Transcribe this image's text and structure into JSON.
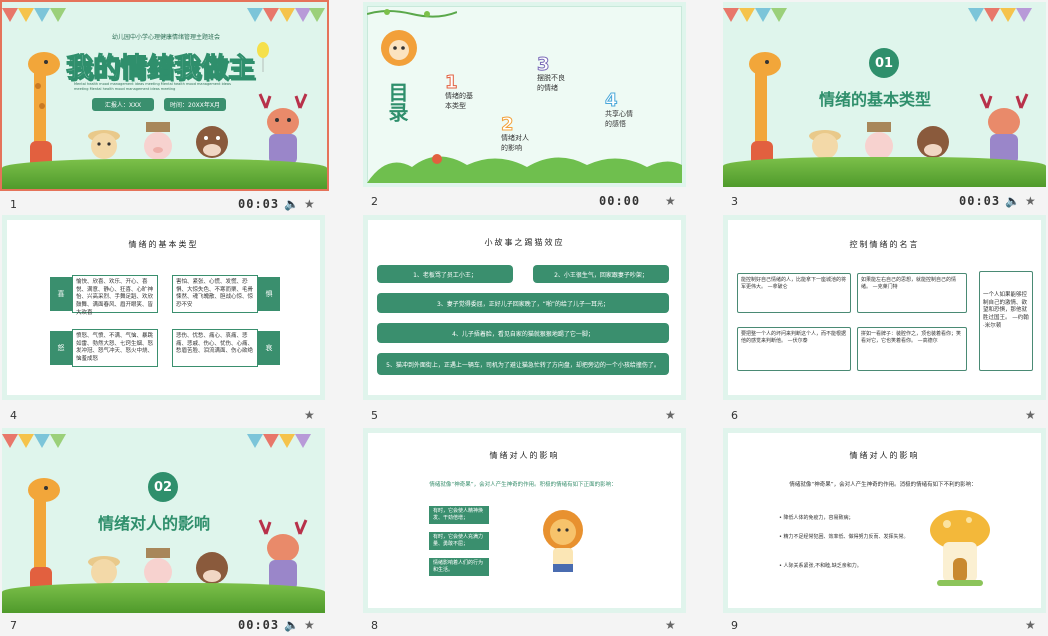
{
  "slides": [
    {
      "num": "1",
      "time": "00:03",
      "title": "我的情绪我做主",
      "subtitle": "幼儿园中小学心理健康情绪管理主题班会",
      "eng": "Mental health mood management ideas meeting Mental health mood management ideas meeting Mental health mood management ideas meeting",
      "reporter": "汇报人：XXX",
      "date": "时间：20XX年X月"
    },
    {
      "num": "2",
      "time": "00:00",
      "toc": "目录",
      "items": [
        {
          "n": "1",
          "text": "情绪的基本类型"
        },
        {
          "n": "2",
          "text": "情绪对人的影响"
        },
        {
          "n": "3",
          "text": "摆脱不良的情绪"
        },
        {
          "n": "4",
          "text": "共享心情的感悟"
        }
      ]
    },
    {
      "num": "3",
      "time": "00:03",
      "badge": "01",
      "title": "情绪的基本类型"
    },
    {
      "num": "4",
      "title": "情绪的基本类型",
      "left": [
        {
          "label": "喜",
          "text": "愉快、欣喜、欢乐、开心、喜悦、满意、静心、狂喜、心旷神怡、兴高采烈、手舞足蹈、欢欣鼓舞、满面春风、眉开眼笑、皆大欢喜"
        },
        {
          "label": "怒",
          "text": "愤怒、气愤、不满、气恼、暴跳如雷、勃然大怒、七窍生烟、怒发冲冠、怒气冲天、怒火中烧、恼羞成怒"
        }
      ],
      "right": [
        {
          "label": "惧",
          "text": "害怕、紧张、心慌、发慌、恐惧、大惊失色、不寒而栗、毛骨悚然、魂飞魄散、胆战心惊、惊恐不安"
        },
        {
          "label": "哀",
          "text": "悲伤、忧愁、痛心、哀痛、悲痛、悲戚、伤心、忧伤、心痛、愁眉苦脸、泪流满面、伤心欲绝"
        }
      ]
    },
    {
      "num": "5",
      "title": "小故事之踢猫效应",
      "lines": [
        "1、老板骂了员工小王；",
        "2、小王很生气，回家跟妻子吵架；",
        "3、妻子觉得委屈，正好儿子回家晚了，“啪”的给了儿子一耳光；",
        "4、儿子捂着脸，看见自家的猫就狠狠地踢了它一脚；",
        "5、猫冲到外面街上，正遇上一辆车，司机为了避让猫急忙转了方向盘，却把旁边的一个小孩给撞伤了。"
      ]
    },
    {
      "num": "6",
      "title": "控制情绪的名言",
      "notes": [
        {
          "text": "能控制好自己情绪的人，比能拿下一座城池的将军更伟大。",
          "by": "—拿破仑"
        },
        {
          "text": "如果能左右自己的思想，就能控制自己的情绪。",
          "by": "—克莱门特"
        },
        {
          "text": "要把整一个人的坏问来判断这个人，而不能根据他的感觉来判断他。",
          "by": "—伏尔泰"
        },
        {
          "text": "拼如一看牌子：装腔作之，顶也装着看你；笑看对它，它也笑着看你。",
          "by": "—高德尔"
        },
        {
          "text": "一个人如果能够控制自己的激情、欲望和恐惧，那他就胜过国王。",
          "by": "—约翰·米尔顿"
        }
      ]
    },
    {
      "num": "7",
      "time": "00:03",
      "badge": "02",
      "title": "情绪对人的影响"
    },
    {
      "num": "8",
      "title": "情绪对人的影响",
      "intro_a": "情绪就像“神奇果”，会对人产生神奇的作用。积极的情绪有如下正面的影响：",
      "boxes": [
        "有时，它会使人精神焕发、干劲倍增；",
        "有时，它会使人充满力量、勇敢不屈；",
        "情绪影响着人们的行为和生活。"
      ]
    },
    {
      "num": "9",
      "title": "情绪对人的影响",
      "intro": "情绪就像“神奇果”，会对人产生神奇的作用。消极的情绪有如下不利的影响：",
      "bullets": [
        "降低人体的免疫力，容易致病；",
        "精力不足经常犯困、效率低、做得努力反而、发挥失常。",
        "人际关系紧张,不和睦,缺乏亲和力。"
      ]
    }
  ],
  "icons": {
    "speaker": "speaker-icon",
    "star": "star-icon"
  },
  "colors": {
    "accent": "#2f8f6c",
    "selection": "#e5735a",
    "mint": "#dff5ec"
  }
}
